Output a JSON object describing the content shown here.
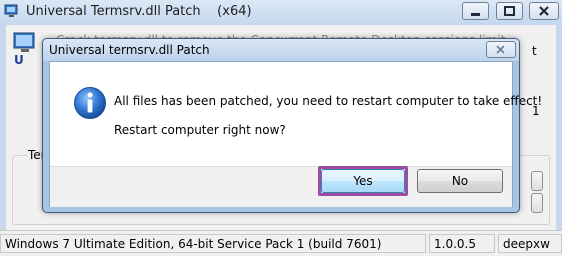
{
  "main_window": {
    "title": "Universal Termsrv.dll Patch    (x64)",
    "background_fragment": "Crack termsrv.dll to remove the Concurrent Remote Desktop sessions limit",
    "group_label": "Term",
    "side_mark_1": "t",
    "side_mark_2": "1"
  },
  "status_bar": {
    "os_info": "Windows 7 Ultimate Edition, 64-bit Service Pack 1 (build 7601)",
    "version": "1.0.0.5",
    "author": "deepxw"
  },
  "dialog": {
    "title": "Universal termsrv.dll Patch",
    "message_line1": "All files has been patched, you need to restart computer to take effect!",
    "message_line2": "Restart computer right now?",
    "yes_label": "Yes",
    "no_label": "No",
    "icon": "info-icon"
  },
  "colors": {
    "titlebar": "#c5d8ee",
    "dialog_frame": "#a8c4e4",
    "focus_outline": "#9b4da4",
    "info_icon": "#1f5fb8"
  }
}
